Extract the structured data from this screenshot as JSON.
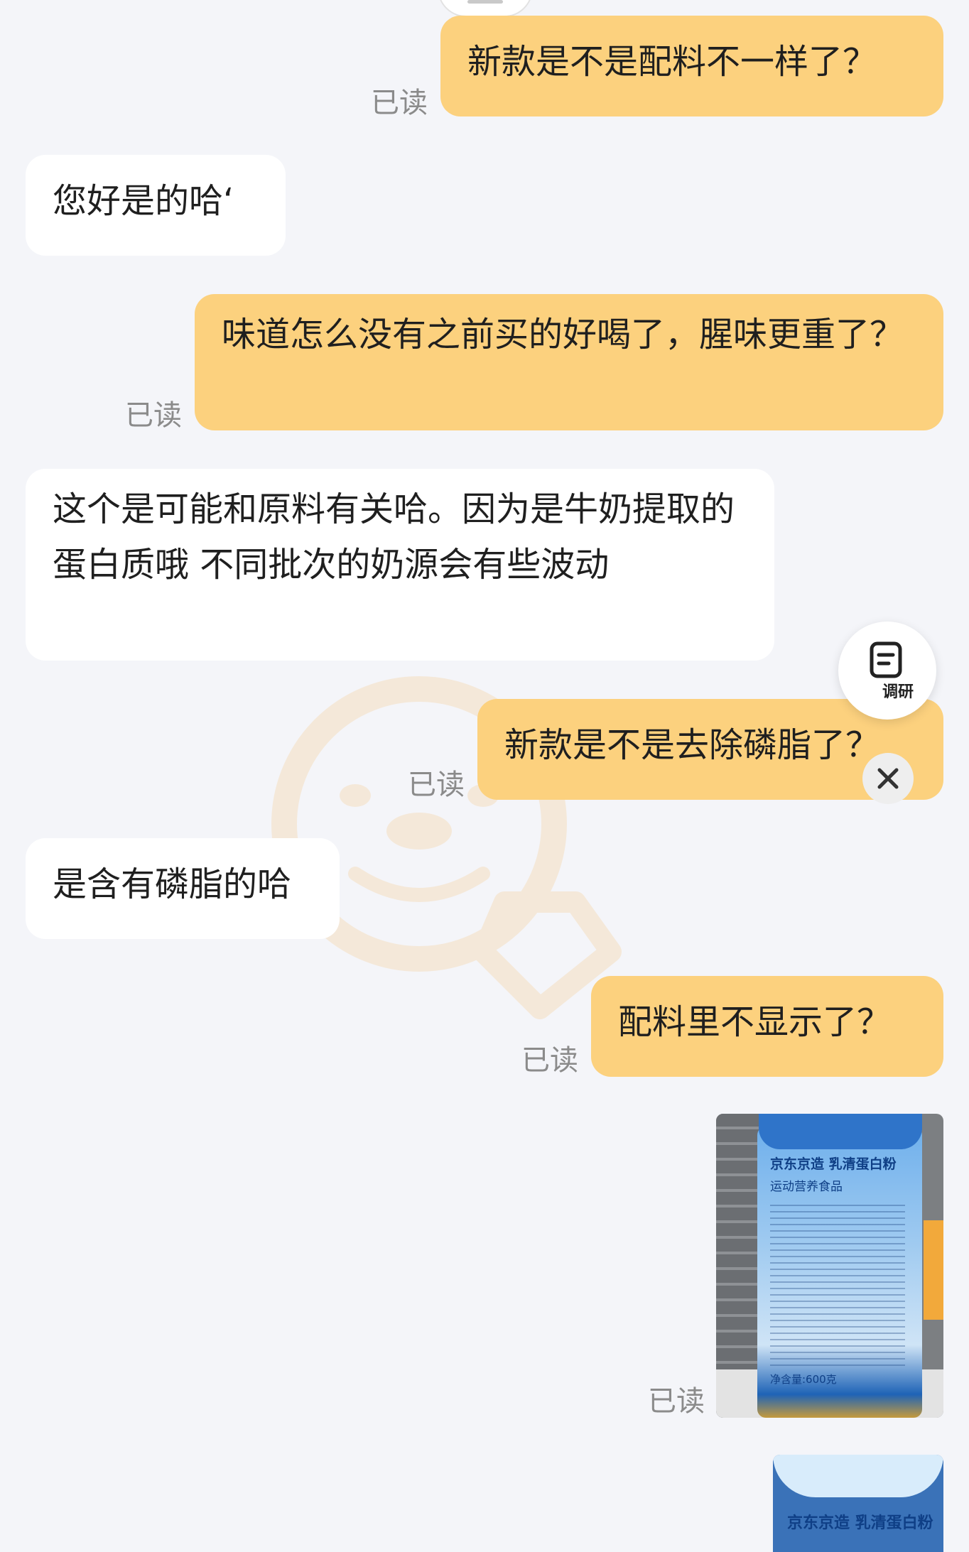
{
  "messages": [
    {
      "from": "me",
      "text": "新款是不是配料不一样了？",
      "status": "已读"
    },
    {
      "from": "them",
      "text": "您好是的哈‘"
    },
    {
      "from": "me",
      "text": "味道怎么没有之前买的好喝了，腥味更重了？",
      "status": "已读"
    },
    {
      "from": "them",
      "text": "这个是可能和原料有关哈。因为是牛奶提取的蛋白质哦   不同批次的奶源会有些波动"
    },
    {
      "from": "me",
      "text": "新款是不是去除磷脂了？",
      "status": "已读"
    },
    {
      "from": "them",
      "text": "是含有磷脂的哈"
    },
    {
      "from": "me",
      "text": "配料里不显示了？",
      "status": "已读"
    },
    {
      "from": "me",
      "type": "image",
      "status": "已读"
    },
    {
      "from": "me",
      "type": "image"
    }
  ],
  "survey": {
    "label": "调研",
    "icon": "survey-icon"
  },
  "close": {
    "icon": "close-icon"
  },
  "photo": {
    "brand": "京东京造 乳清蛋白粉",
    "subtitle": "运动营养食品",
    "net": "净含量:600克"
  },
  "photo2": {
    "brand": "京东京造 乳清蛋白粉"
  },
  "colors": {
    "my_bubble": "#fcd17e",
    "their_bubble": "#ffffff",
    "background": "#f4f5f9",
    "read_status": "#8b8b8b"
  }
}
